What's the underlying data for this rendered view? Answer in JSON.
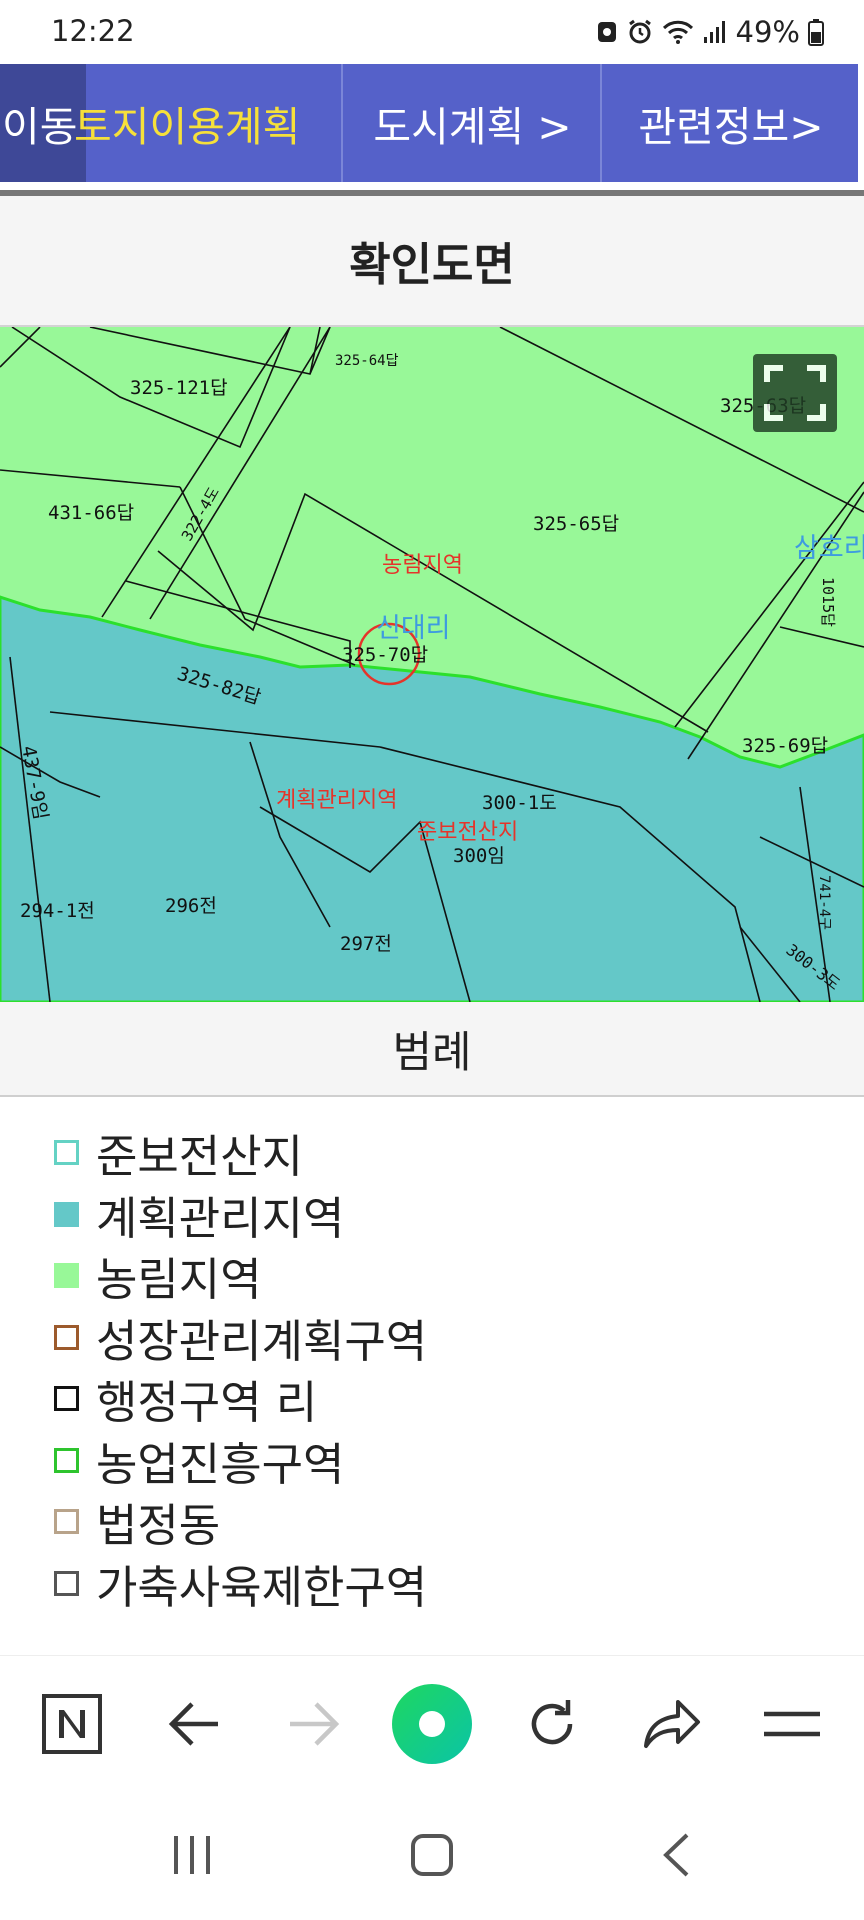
{
  "status_bar": {
    "time": "12:22",
    "battery": "49%",
    "icons": [
      "notification-icon",
      "alarm-icon",
      "wifi-icon",
      "signal-icon",
      "battery-icon"
    ]
  },
  "tabs": {
    "prev_label": "이동",
    "land_use_label": "토지이용계획",
    "city_plan_label": "도시계획 >",
    "related_info_label": "관련정보>"
  },
  "section": {
    "title": "확인도면"
  },
  "map": {
    "parcels": {
      "p325_121": "325-121답",
      "p325_64": "325-64답",
      "p325_63": "325-63답",
      "p431_66": "431-66답",
      "p325_65": "325-65답",
      "p325_70": "325-70답",
      "p325_82": "325-82답",
      "p325_69": "325-69답",
      "p437_9": "437-9임",
      "p300_1": "300-1도",
      "p300": "300임",
      "p294_1": "294-1전",
      "p296": "296전",
      "p297": "297전",
      "p300_3": "300-3도",
      "p1015": "1015답",
      "p741_4": "741-4구",
      "p322_4": "322-4도"
    },
    "zones": {
      "forest": "농림지역",
      "planned": "계획관리지역",
      "semi_forest": "준보전산지"
    },
    "villages": {
      "sindae": "신대리",
      "samho": "삼호리"
    },
    "colors": {
      "forest_fill": "#98f898",
      "planned_fill": "#64c8c8",
      "zone_text": "#e5342a",
      "village_text": "#3e9be0"
    }
  },
  "legend": {
    "title": "범례",
    "items": [
      {
        "label": "준보전산지",
        "swatch_fill": "#ffffff",
        "swatch_border": "#64d2c4"
      },
      {
        "label": "계획관리지역",
        "swatch_fill": "#64c8c8",
        "swatch_border": "#64c8c8"
      },
      {
        "label": "농림지역",
        "swatch_fill": "#98f898",
        "swatch_border": "#98f898"
      },
      {
        "label": "성장관리계획구역",
        "swatch_fill": "#ffffff",
        "swatch_border": "#9c5a2c"
      },
      {
        "label": "행정구역 리",
        "swatch_fill": "#ffffff",
        "swatch_border": "#111111"
      },
      {
        "label": "농업진흥구역",
        "swatch_fill": "#ffffff",
        "swatch_border": "#2ec42e"
      },
      {
        "label": "법정동",
        "swatch_fill": "#ffffff",
        "swatch_border": "#b8a38a"
      },
      {
        "label": "가축사육제한구역",
        "swatch_fill": "#ffffff",
        "swatch_border": "#555555"
      }
    ]
  },
  "browser_toolbar": {
    "buttons": [
      "naver-home-icon",
      "back-icon",
      "forward-icon",
      "green-dot-icon",
      "refresh-icon",
      "share-icon",
      "menu-icon"
    ],
    "accent": "#11d38a"
  },
  "system_nav": {
    "buttons": [
      "recent-apps-icon",
      "home-icon",
      "back-nav-icon"
    ]
  }
}
